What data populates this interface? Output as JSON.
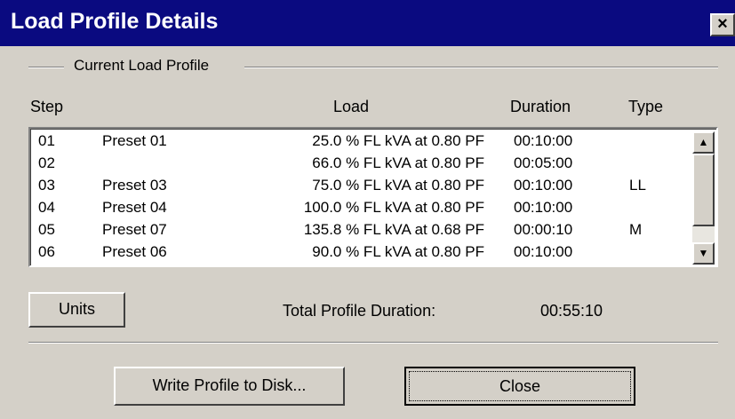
{
  "window": {
    "title": "Load Profile Details",
    "close_glyph": "×"
  },
  "group": {
    "label": "Current Load Profile"
  },
  "headers": {
    "step": "Step",
    "load": "Load",
    "duration": "Duration",
    "type": "Type"
  },
  "rows": [
    {
      "step": "01",
      "name": "Preset 01",
      "load": "25.0 % FL kVA at 0.80 PF",
      "duration": "00:10:00",
      "type": ""
    },
    {
      "step": "02",
      "name": "",
      "load": "66.0 % FL kVA at 0.80 PF",
      "duration": "00:05:00",
      "type": ""
    },
    {
      "step": "03",
      "name": "Preset 03",
      "load": "75.0 % FL kVA at 0.80 PF",
      "duration": "00:10:00",
      "type": "LL"
    },
    {
      "step": "04",
      "name": "Preset 04",
      "load": "100.0 % FL kVA at 0.80 PF",
      "duration": "00:10:00",
      "type": ""
    },
    {
      "step": "05",
      "name": "Preset 07",
      "load": "135.8 % FL kVA at 0.68 PF",
      "duration": "00:00:10",
      "type": "M"
    },
    {
      "step": "06",
      "name": "Preset 06",
      "load": "90.0 % FL kVA at 0.80 PF",
      "duration": "00:10:00",
      "type": ""
    }
  ],
  "scroll": {
    "up_glyph": "▲",
    "down_glyph": "▼"
  },
  "buttons": {
    "units": "Units",
    "write": "Write Profile to Disk...",
    "close": "Close"
  },
  "totals": {
    "label": "Total Profile Duration:",
    "value": "00:55:10"
  },
  "colors": {
    "titlebar": "#0a0a80",
    "face": "#d4d0c8"
  }
}
